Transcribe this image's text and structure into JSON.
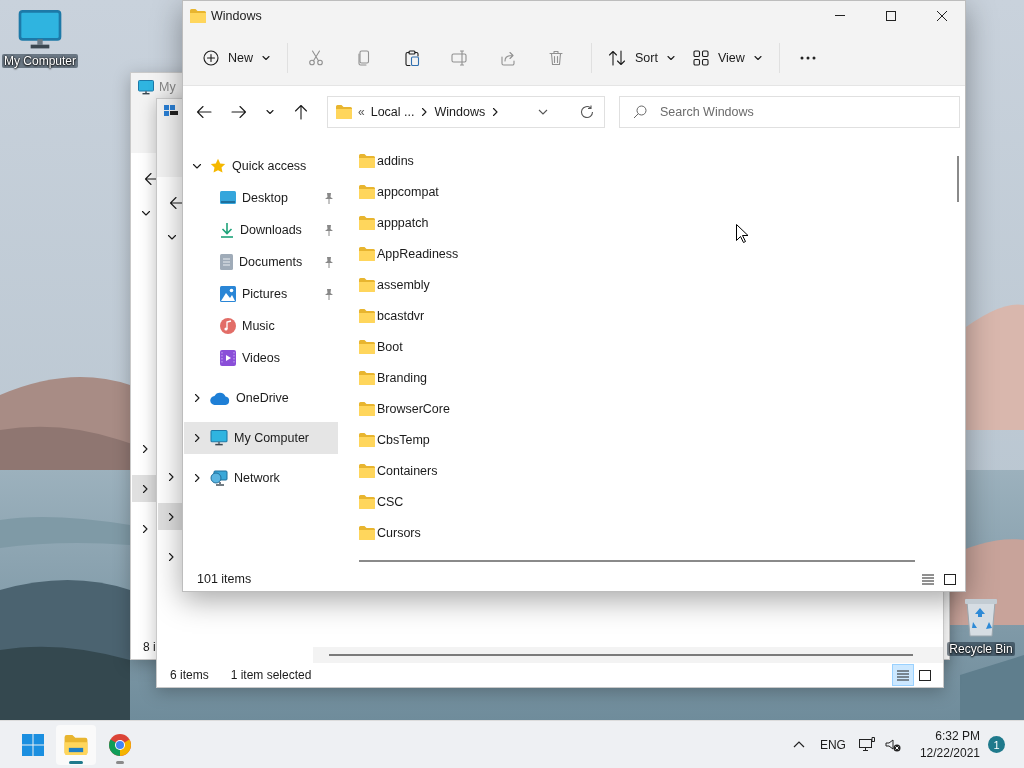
{
  "desktop_icons": [
    {
      "label": "My Computer"
    },
    {
      "label": "Recycle Bin"
    }
  ],
  "back_windows": [
    {
      "title": "My",
      "nav_rows": [
        {
          "selected": false
        },
        {
          "selected": true
        },
        {
          "selected": false
        }
      ],
      "status": [
        "8 i"
      ]
    },
    {
      "nav_rows": [
        {
          "selected": false
        },
        {
          "selected": true
        },
        {
          "selected": false
        }
      ],
      "status": [
        "6 items",
        "1 item selected"
      ],
      "views": [
        {
          "selected": true
        },
        {
          "selected": false
        }
      ]
    }
  ],
  "window": {
    "title": "Windows",
    "toolbar": [
      {
        "kind": "menu",
        "label": "New"
      },
      {
        "kind": "action",
        "disabled": true
      },
      {
        "kind": "action",
        "disabled": true
      },
      {
        "kind": "action",
        "disabled": false
      },
      {
        "kind": "action",
        "disabled": true
      },
      {
        "kind": "action",
        "disabled": true
      },
      {
        "kind": "action",
        "disabled": true
      },
      {
        "kind": "menu",
        "label": "Sort"
      },
      {
        "kind": "menu",
        "label": "View"
      },
      {
        "kind": "more"
      }
    ],
    "address": {
      "crumbs": [
        "«",
        "Local ...",
        "Windows"
      ]
    },
    "search": {
      "placeholder": "Search Windows"
    },
    "sidebar": {
      "items": [
        {
          "label": "Quick access",
          "expanded": true,
          "selected": false,
          "children": [
            {
              "label": "Desktop",
              "pinned": true,
              "selected": false
            },
            {
              "label": "Downloads",
              "pinned": true,
              "selected": false
            },
            {
              "label": "Documents",
              "pinned": true,
              "selected": false
            },
            {
              "label": "Pictures",
              "pinned": true,
              "selected": false
            },
            {
              "label": "Music",
              "pinned": false,
              "selected": false
            },
            {
              "label": "Videos",
              "pinned": false,
              "selected": false
            }
          ]
        },
        {
          "label": "OneDrive",
          "expanded": false,
          "selected": false
        },
        {
          "label": "My Computer",
          "expanded": false,
          "selected": true
        },
        {
          "label": "Network",
          "expanded": false,
          "selected": false
        }
      ]
    },
    "files": [
      {
        "name": "addins",
        "selected": false
      },
      {
        "name": "appcompat",
        "selected": false
      },
      {
        "name": "apppatch",
        "selected": false
      },
      {
        "name": "AppReadiness",
        "selected": false
      },
      {
        "name": "assembly",
        "selected": false
      },
      {
        "name": "bcastdvr",
        "selected": false
      },
      {
        "name": "Boot",
        "selected": false
      },
      {
        "name": "Branding",
        "selected": false
      },
      {
        "name": "BrowserCore",
        "selected": false
      },
      {
        "name": "CbsTemp",
        "selected": false
      },
      {
        "name": "Containers",
        "selected": false
      },
      {
        "name": "CSC",
        "selected": false
      },
      {
        "name": "Cursors",
        "selected": false
      }
    ],
    "status_bar": {
      "text": "101 items",
      "views": [
        {
          "selected": false
        },
        {
          "selected": false
        }
      ]
    }
  },
  "taskbar": {
    "apps": [
      {
        "active": true,
        "running": true
      },
      {
        "active": false,
        "running": true
      }
    ],
    "language": "ENG",
    "time": "6:32 PM",
    "date": "12/22/2021",
    "notifications": "1"
  }
}
